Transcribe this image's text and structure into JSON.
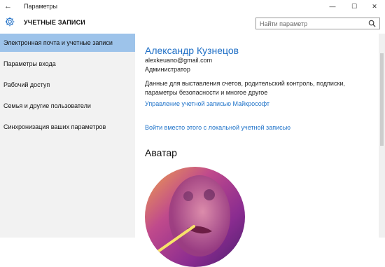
{
  "window": {
    "title": "Параметры",
    "back_glyph": "←",
    "minimize_glyph": "—",
    "maximize_glyph": "☐",
    "close_glyph": "✕"
  },
  "header": {
    "section_title": "УЧЕТНЫЕ ЗАПИСИ",
    "icon": "gear-icon"
  },
  "search": {
    "placeholder": "Найти параметр",
    "icon": "search-icon"
  },
  "sidebar": {
    "items": [
      {
        "label": "Электронная почта и учетные записи",
        "active": true
      },
      {
        "label": "Параметры входа",
        "active": false
      },
      {
        "label": "Рабочий доступ",
        "active": false
      },
      {
        "label": "Семья и другие пользователи",
        "active": false
      },
      {
        "label": "Синхронизация ваших параметров",
        "active": false
      }
    ]
  },
  "account": {
    "name": "Александр Кузнецов",
    "email": "alexkeuano@gmail.com",
    "role": "Администратор",
    "description": "Данные для выставления счетов, родительский контроль, подписки, параметры безопасности и многое другое",
    "manage_link": "Управление учетной записью Майкрософт",
    "local_link": "Войти вместо этого с локальной учетной записью"
  },
  "avatar": {
    "title": "Аватар"
  },
  "colors": {
    "accent": "#1f6fc6",
    "sidebar_bg": "#f2f2f2",
    "active_item": "#9dc3ea"
  }
}
